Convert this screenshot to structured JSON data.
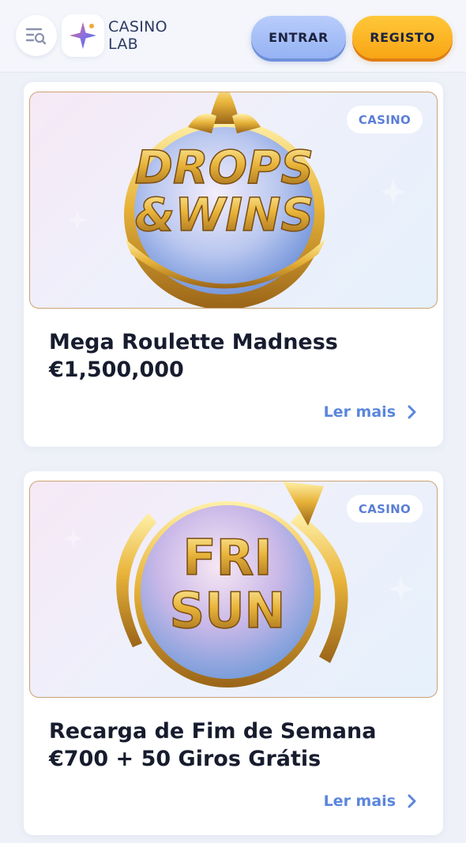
{
  "header": {
    "logo": {
      "line1": "CASINO",
      "line2": "LAB"
    },
    "login_label": "ENTRAR",
    "register_label": "REGISTO",
    "menu_icon": "menu-search-icon"
  },
  "colors": {
    "login_button": "#a9c1f8",
    "register_button": "#fbb526",
    "link": "#5b86dc",
    "badge_text": "#5b7ed6",
    "banner_border": "#cda172"
  },
  "promotions": [
    {
      "banner_text": [
        "DROPS",
        "&WINS"
      ],
      "category": "CASINO",
      "title_line1": "Mega Roulette Madness",
      "title_line2": "€1,500,000",
      "link_label": "Ler mais"
    },
    {
      "banner_text": [
        "FRI",
        "SUN"
      ],
      "category": "CASINO",
      "title_line1": "Recarga de Fim de Semana",
      "title_line2": "€700 + 50 Giros Grátis",
      "link_label": "Ler mais"
    }
  ]
}
